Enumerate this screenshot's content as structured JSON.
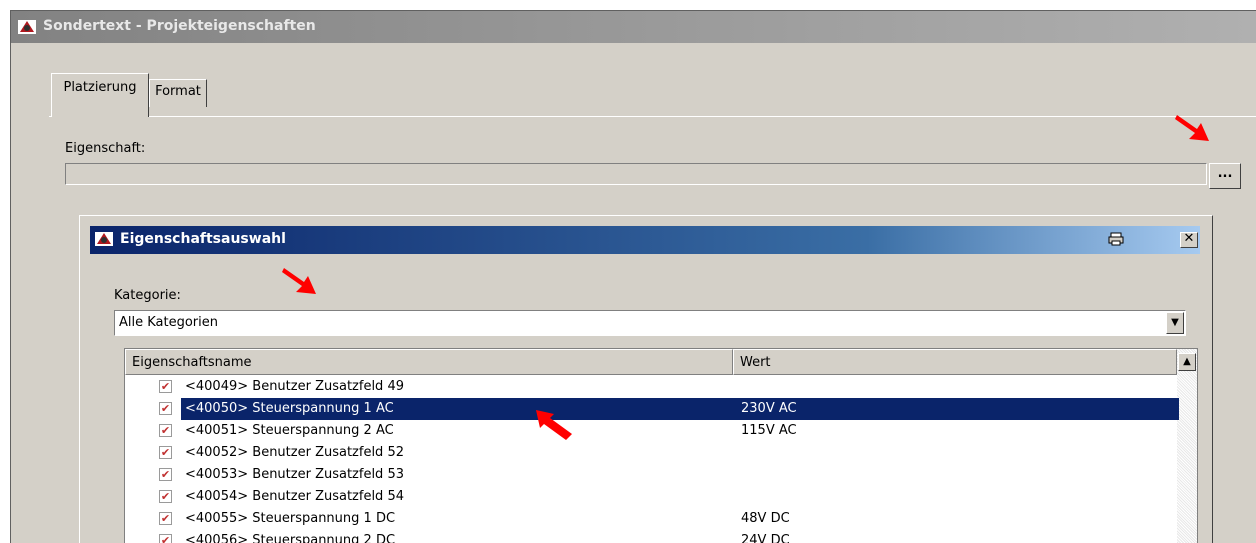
{
  "outer_window": {
    "title": "Sondertext - Projekteigenschaften",
    "tabs": [
      {
        "label": "Platzierung",
        "active": true
      },
      {
        "label": "Format",
        "active": false
      }
    ],
    "property_label": "Eigenschaft:",
    "property_value": "",
    "browse_button_label": "..."
  },
  "dialog": {
    "title": "Eigenschaftsauswahl",
    "category_label": "Kategorie:",
    "category_value": "Alle Kategorien",
    "columns": [
      "Eigenschaftsname",
      "Wert"
    ],
    "rows": [
      {
        "name": "<40049> Benutzer Zusatzfeld 49",
        "value": "",
        "checked": true,
        "selected": false
      },
      {
        "name": "<40050> Steuerspannung 1 AC",
        "value": "230V AC",
        "checked": true,
        "selected": true
      },
      {
        "name": "<40051> Steuerspannung 2 AC",
        "value": "115V AC",
        "checked": true,
        "selected": false
      },
      {
        "name": "<40052> Benutzer Zusatzfeld 52",
        "value": "",
        "checked": true,
        "selected": false
      },
      {
        "name": "<40053> Benutzer Zusatzfeld 53",
        "value": "",
        "checked": true,
        "selected": false
      },
      {
        "name": "<40054> Benutzer Zusatzfeld 54",
        "value": "",
        "checked": true,
        "selected": false
      },
      {
        "name": "<40055> Steuerspannung 1 DC",
        "value": "48V DC",
        "checked": true,
        "selected": false
      },
      {
        "name": "<40056> Steuerspannung 2 DC",
        "value": "24V DC",
        "checked": true,
        "selected": false
      }
    ]
  },
  "icons": {
    "app": "app-logo-icon",
    "print": "print-icon",
    "close": "close-icon",
    "dropdown": "chevron-down-icon",
    "scroll_up": "scroll-up-icon",
    "annotation": "red-arrow-icon"
  },
  "colors": {
    "title_active_start": "#0a246a",
    "title_active_end": "#a6caf0",
    "title_inactive": "#828282",
    "selection": "#0a246a",
    "annotation_arrow": "#ff0000"
  }
}
